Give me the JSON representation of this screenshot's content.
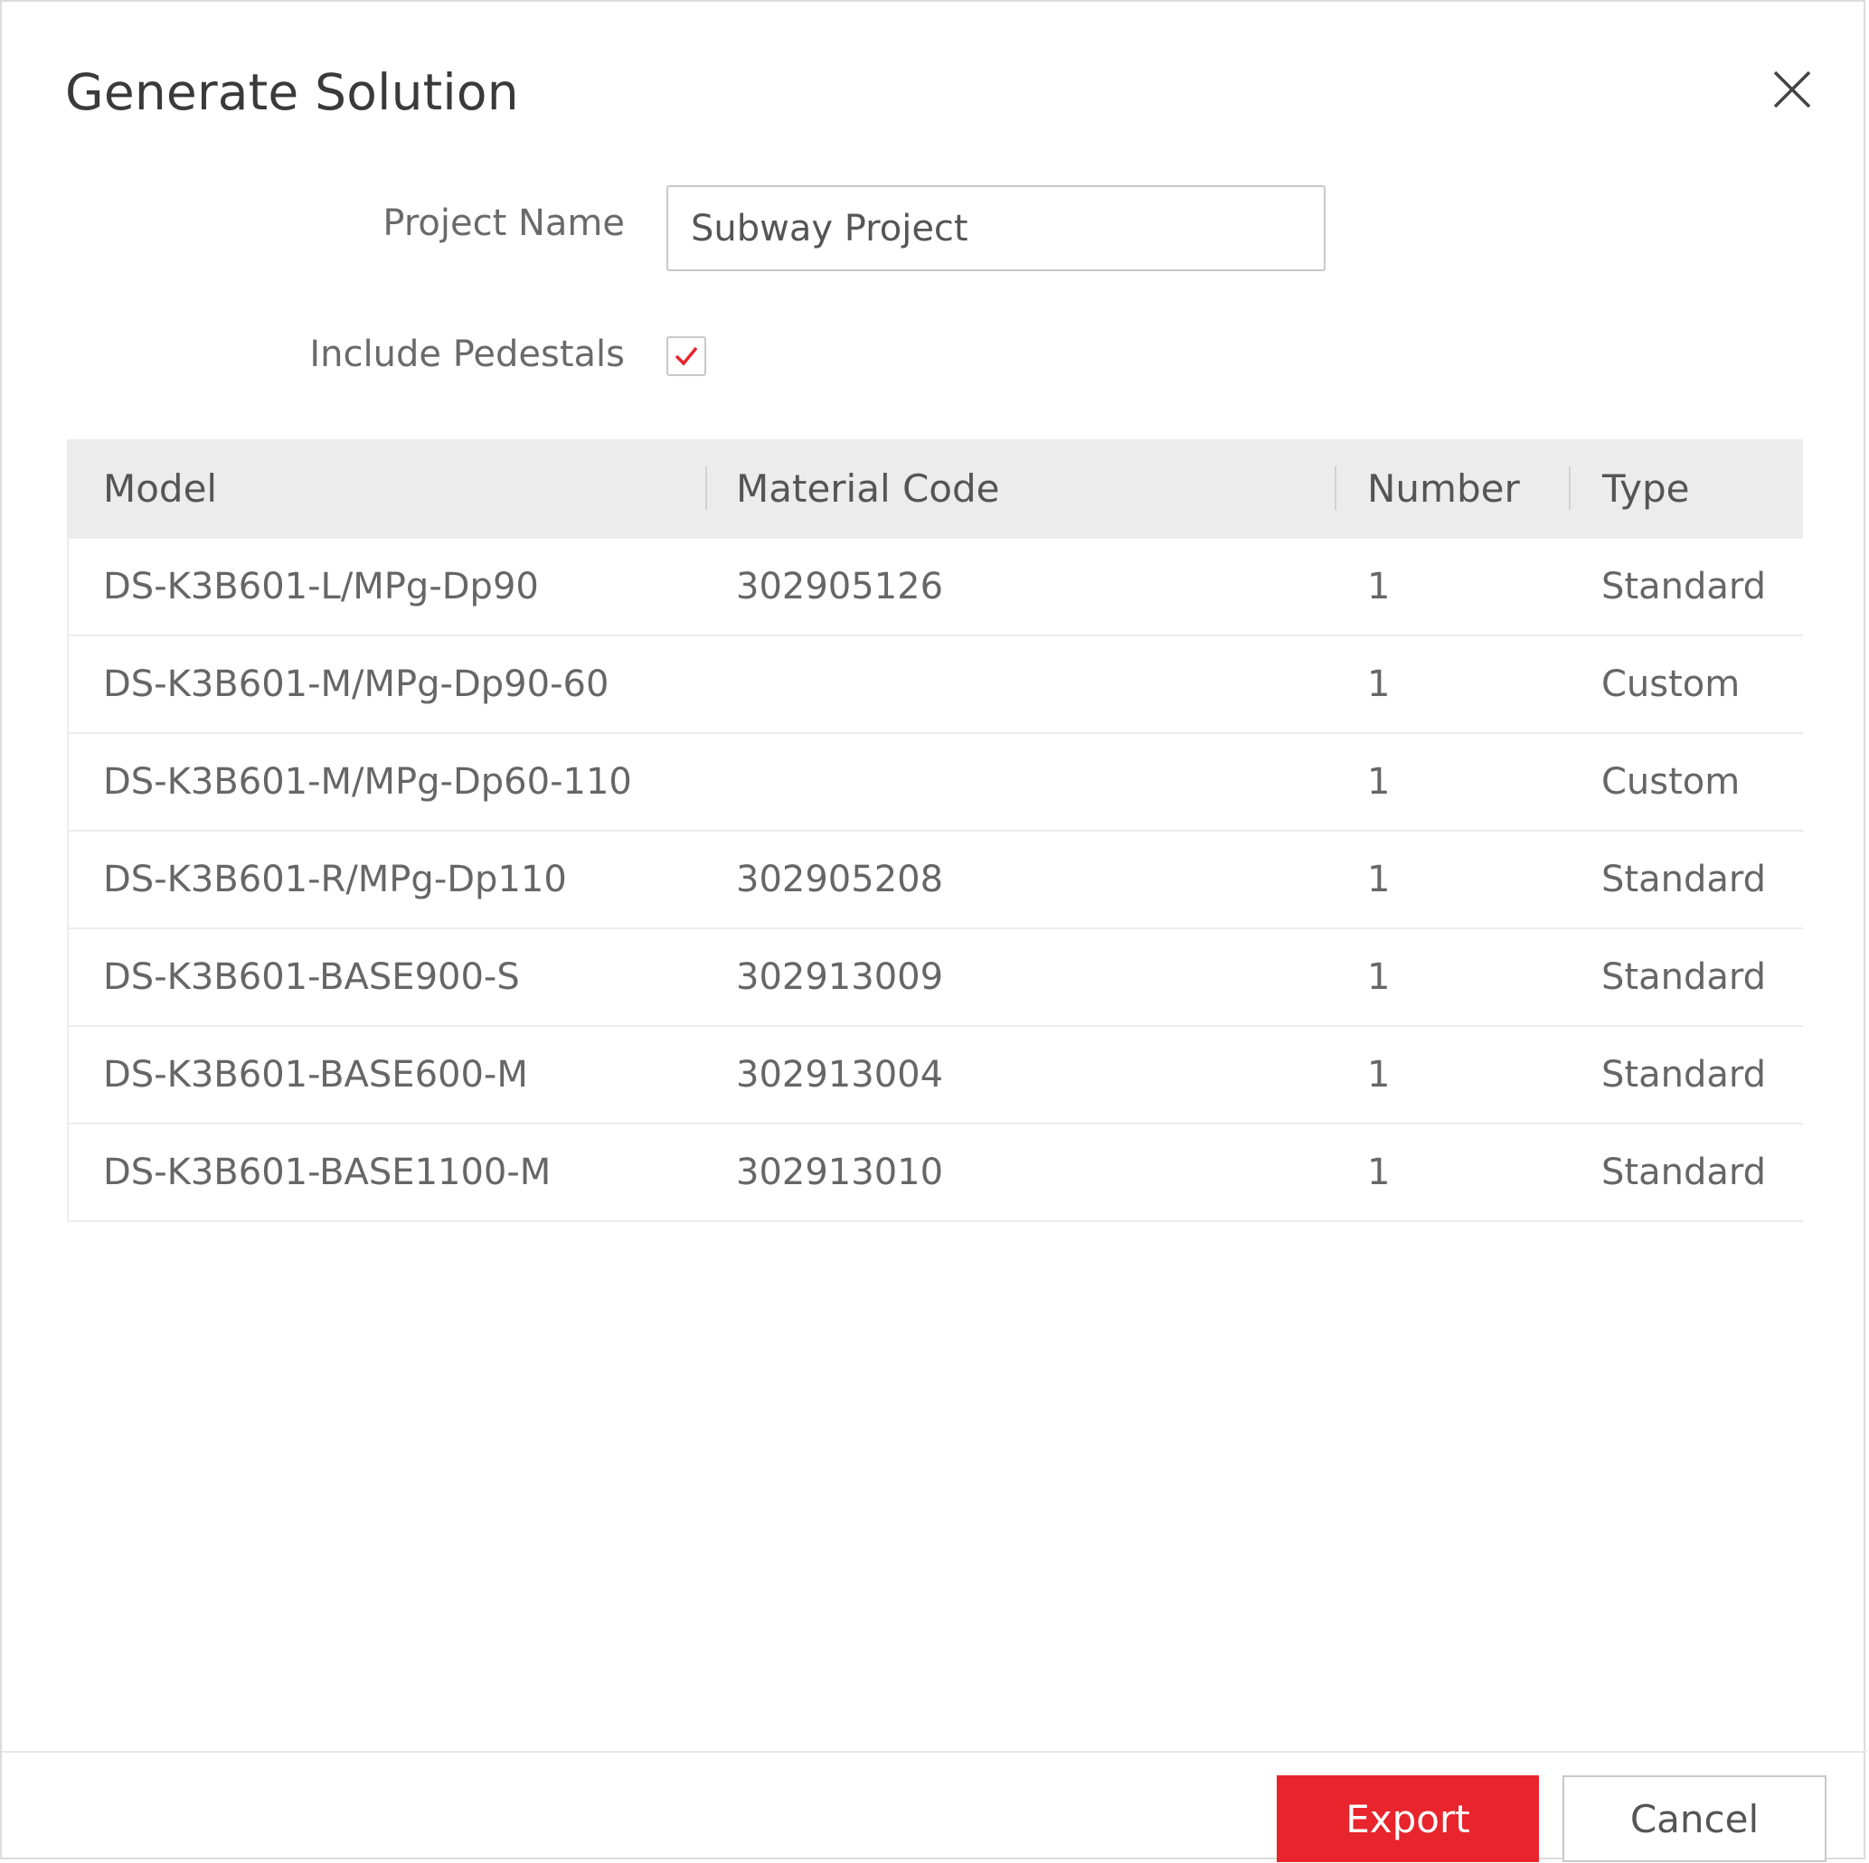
{
  "dialog": {
    "title": "Generate Solution",
    "close_icon": "close-icon"
  },
  "form": {
    "project_name_label": "Project Name",
    "project_name_value": "Subway Project",
    "include_pedestals_label": "Include Pedestals",
    "include_pedestals_checked": true,
    "check_color": "#e8242c"
  },
  "table": {
    "headers": {
      "model": "Model",
      "material_code": "Material Code",
      "number": "Number",
      "type": "Type"
    },
    "rows": [
      {
        "model": "DS-K3B601-L/MPg-Dp90",
        "material_code": "302905126",
        "number": "1",
        "type": "Standard"
      },
      {
        "model": "DS-K3B601-M/MPg-Dp90-60",
        "material_code": "",
        "number": "1",
        "type": "Custom"
      },
      {
        "model": "DS-K3B601-M/MPg-Dp60-110",
        "material_code": "",
        "number": "1",
        "type": "Custom"
      },
      {
        "model": "DS-K3B601-R/MPg-Dp110",
        "material_code": "302905208",
        "number": "1",
        "type": "Standard"
      },
      {
        "model": "DS-K3B601-BASE900-S",
        "material_code": "302913009",
        "number": "1",
        "type": "Standard"
      },
      {
        "model": "DS-K3B601-BASE600-M",
        "material_code": "302913004",
        "number": "1",
        "type": "Standard"
      },
      {
        "model": "DS-K3B601-BASE1100-M",
        "material_code": "302913010",
        "number": "1",
        "type": "Standard"
      }
    ]
  },
  "footer": {
    "export_label": "Export",
    "cancel_label": "Cancel",
    "export_color": "#e8242c"
  }
}
